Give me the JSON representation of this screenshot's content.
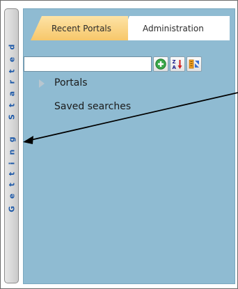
{
  "getting_started": {
    "label": "Getting Started"
  },
  "tabs": [
    {
      "label": "Recent Portals",
      "active": true
    },
    {
      "label": "Administration",
      "active": false
    }
  ],
  "search": {
    "value": "",
    "placeholder": ""
  },
  "toolbar": {
    "icons": [
      "add-icon",
      "sort-az-icon",
      "expand-collapse-icon"
    ]
  },
  "tree": {
    "items": [
      {
        "label": "Portals",
        "expandable": true
      },
      {
        "label": "Saved searches",
        "expandable": false
      }
    ]
  },
  "colors": {
    "panel_bg": "#8fbbd2",
    "active_tab": "#f7c76a",
    "strip_text": "#1f5aa8"
  }
}
